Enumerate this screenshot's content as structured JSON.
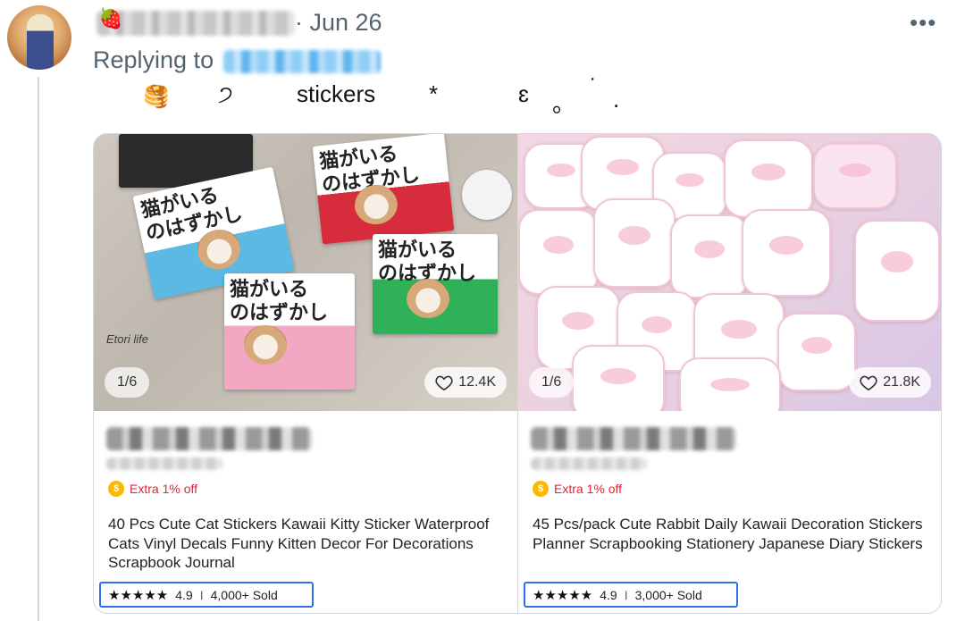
{
  "tweet": {
    "date": "· Jun 26",
    "more_label": "•••",
    "replying_to_label": "Replying to",
    "name_emoji": "🍓",
    "text": {
      "emoji": "🥞",
      "glyph1": "੭",
      "word": "stickers",
      "glyph2": "*",
      "glyph3": "ɛ",
      "glyph4": "。",
      "glyph5": "˙",
      "glyph6": "."
    }
  },
  "products": [
    {
      "image_counter": "1/6",
      "likes": "12.4K",
      "image_text": "Etori life",
      "box_text": "猫がいる\nのはずかし",
      "promo": "Extra 1% off",
      "title": "40 Pcs Cute Cat Stickers Kawaii Kitty Sticker Waterproof Cats Vinyl Decals Funny Kitten Decor For Decorations Scrapbook Journal",
      "stars": "★★★★★",
      "rating": "4.9",
      "separator": "I",
      "sold": "4,000+ Sold"
    },
    {
      "image_counter": "1/6",
      "likes": "21.8K",
      "promo": "Extra 1% off",
      "title": "45 Pcs/pack Cute Rabbit Daily Kawaii Decoration Stickers Planner Scrapbooking Stationery Japanese Diary Stickers",
      "stars": "★★★★★",
      "rating": "4.9",
      "separator": "I",
      "sold": "3,000+ Sold"
    }
  ],
  "colors": {
    "accent_blue": "#2f6fe8",
    "promo_red": "#e6232f",
    "coin_yellow": "#ffb800",
    "muted_text": "#536471"
  }
}
